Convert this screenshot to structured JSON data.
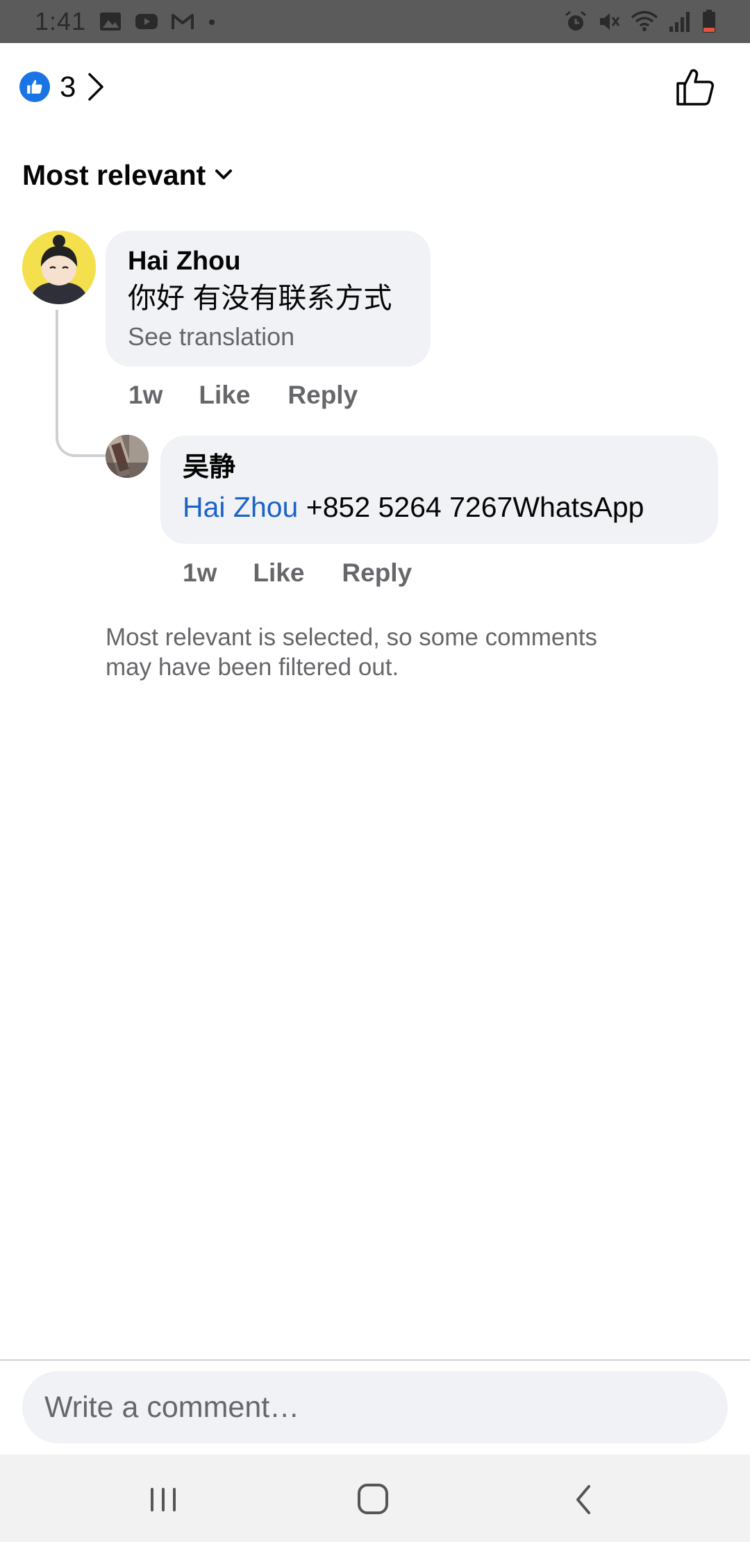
{
  "status_bar": {
    "time": "1:41",
    "left_icons": [
      "image-icon",
      "youtube-icon",
      "gmail-icon",
      "dot-icon"
    ],
    "right_icons": [
      "alarm-icon",
      "mute-icon",
      "wifi-icon",
      "signal-icon",
      "battery-icon"
    ]
  },
  "header": {
    "reaction_icon": "like-icon",
    "reaction_count": "3",
    "like_button_icon": "thumbs-up-outline-icon"
  },
  "sort": {
    "label": "Most relevant"
  },
  "comments": [
    {
      "author": "Hai Zhou",
      "text": "你好 有没有联系方式",
      "see_translation": "See translation",
      "time": "1w",
      "like_label": "Like",
      "reply_label": "Reply",
      "replies": [
        {
          "author": "吴静",
          "mention": "Hai Zhou",
          "text": " +852 5264 7267WhatsApp",
          "time": "1w",
          "like_label": "Like",
          "reply_label": "Reply"
        }
      ]
    }
  ],
  "filter_note": "Most relevant is selected, so some comments may have been filtered out.",
  "composer": {
    "placeholder": "Write a comment…"
  },
  "colors": {
    "accent": "#1b74e4",
    "mention": "#1b63c7",
    "bubble": "#f0f2f5",
    "secondary_text": "#65676b"
  }
}
